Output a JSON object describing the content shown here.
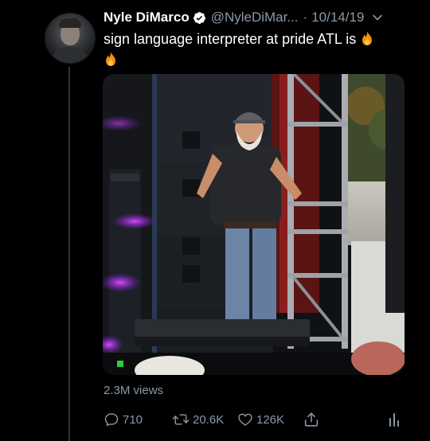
{
  "tweet": {
    "author_name": "Nyle DiMarco",
    "handle": "@NyleDiMar...",
    "separator": "·",
    "date": "10/14/19",
    "text": "sign language interpreter at pride ATL is",
    "views": "2.3M views"
  },
  "actions": {
    "replies": "710",
    "retweets": "20.6K",
    "likes": "126K"
  },
  "icons": {
    "verified": "verified-badge-icon",
    "more": "chevron-down-icon",
    "emoji": "fire-emoji",
    "reply": "reply-icon",
    "retweet": "retweet-icon",
    "like": "heart-icon",
    "share": "share-icon",
    "analytics": "analytics-icon"
  },
  "colors": {
    "background": "#000000",
    "text_primary": "#ffffff",
    "text_secondary": "#8b98a5",
    "thread_line": "#2f3336"
  }
}
